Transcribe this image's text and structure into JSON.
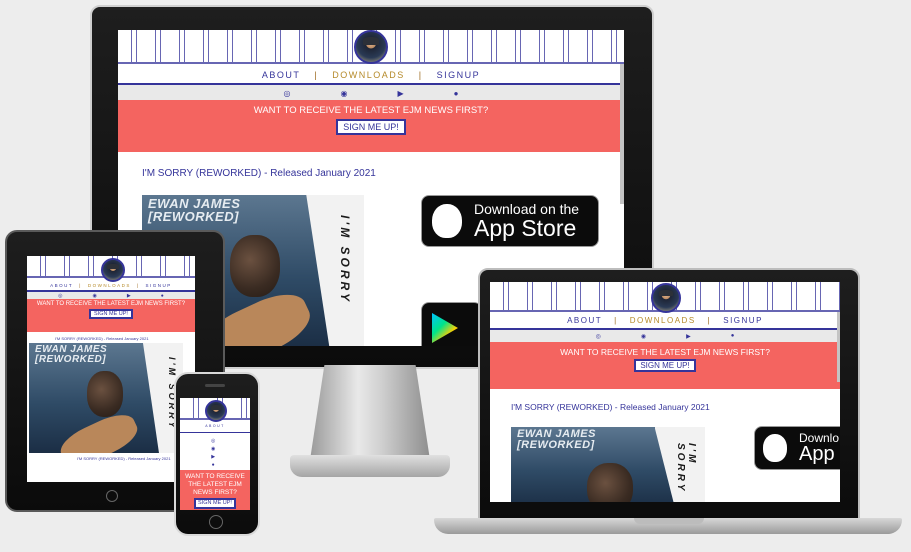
{
  "nav": {
    "about": "ABOUT",
    "downloads": "DOWNLOADS",
    "signup": "SIGNUP",
    "separator": "|"
  },
  "socials": {
    "icons": [
      "instagram-icon",
      "spotify-icon",
      "youtube-icon",
      "apple-icon"
    ]
  },
  "banner": {
    "text": "WANT TO RECEIVE THE LATEST EJM NEWS FIRST?",
    "button": "SIGN ME UP!",
    "color": "#f46460"
  },
  "release": {
    "text": "I'M SORRY (REWORKED) - Released January 2021"
  },
  "cover": {
    "artist": "EWAN JAMES",
    "subtitle": "[REWORKED]",
    "side_text": "I'M SORRY"
  },
  "store": {
    "appstore_small": "Download on the",
    "appstore_big": "App Store",
    "appstore_big_cut": "App",
    "appstore_small_cut": "Downlo"
  },
  "phone": {
    "banner_text": "WANT TO RECEIVE THE LATEST EJM NEWS FIRST?",
    "nav_label": "ABOUT"
  },
  "colors": {
    "brand": "#35349a",
    "accent": "#b58a2a",
    "banner": "#f46460"
  }
}
